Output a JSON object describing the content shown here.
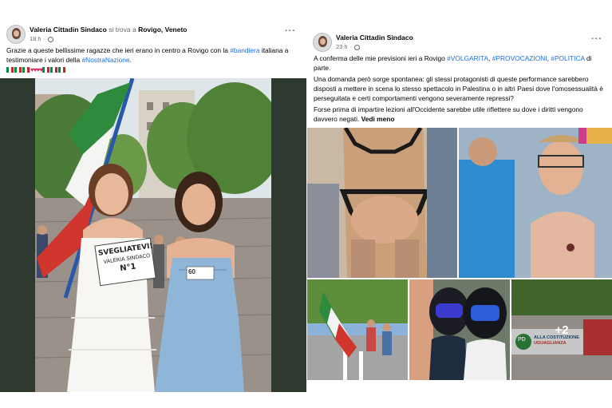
{
  "left_post": {
    "author": "Valeria Cittadin Sindaco",
    "location_prefix": "si trova a",
    "location": "Rovigo, Veneto",
    "timestamp": "18 h",
    "dot": "·",
    "more": "···",
    "text_part1": "Grazie a queste bellissime ragazze che ieri erano in centro a Rovigo con la ",
    "hashtag1": "#bandiera",
    "text_part2": " italiana a testimoniare i valori della ",
    "hashtag2": "#NostraNazione",
    "text_part3": ".",
    "sign_text_1": "SVEGLIATEVI!",
    "sign_text_2": "VALERIA SINDACO",
    "sign_text_3": "N°1",
    "badge_text": "60"
  },
  "right_post": {
    "author": "Valeria Cittadin Sindaco",
    "timestamp": "23 h",
    "dot": "·",
    "more": "···",
    "p1_text": "A conferma delle mie previsioni ieri a Rovigo ",
    "p1_tag1": "#VOLGARITA",
    "p1_sep1": ", ",
    "p1_tag2": "#PROVOCAZIONI",
    "p1_sep2": ", ",
    "p1_tag3": "#POLITICA",
    "p1_end": " di parte.",
    "p2": "Una domanda però sorge spontanea: gli stessi protagonisti di queste performance sarebbero disposti a mettere in scena lo stesso spettacolo in Palestina o in altri Paesi dove l'omosessualità è perseguitata e certi comportamenti vengono severamente repressi?",
    "p3": "Forse prima di impartire lezioni all'Occidente sarebbe utile riflettere su dove i diritti vengono davvero negati.",
    "see_more": "Vedi meno",
    "more_photos": "+2",
    "banner_text_1": "ALLA COSTITUZIONE",
    "banner_text_2": "UGUAGLIANZA",
    "banner_text_3": "PD"
  }
}
